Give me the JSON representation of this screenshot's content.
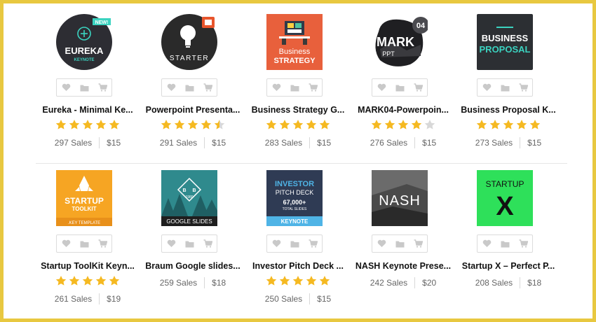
{
  "colors": {
    "star": "#f5b921",
    "star_empty": "#d8d8d8",
    "accent_gray": "#c9c9c9"
  },
  "action_icons": [
    "heart-icon",
    "folder-icon",
    "cart-icon"
  ],
  "items": [
    {
      "title": "Eureka - Minimal Ke...",
      "rating": 5,
      "sales": "297 Sales",
      "price": "$15",
      "thumb": {
        "name": "EUREKA",
        "sub": "KEYNOTE",
        "badge": "NEW!"
      }
    },
    {
      "title": "Powerpoint Presenta...",
      "rating": 4.5,
      "sales": "291 Sales",
      "price": "$15",
      "thumb": {
        "name": "STARTER"
      }
    },
    {
      "title": "Business Strategy G...",
      "rating": 5,
      "sales": "283 Sales",
      "price": "$15",
      "thumb": {
        "line1": "Business",
        "line2": "STRATEGY"
      }
    },
    {
      "title": "MARK04-Powerpoin...",
      "rating": 4,
      "sales": "276 Sales",
      "price": "$15",
      "thumb": {
        "name": "MARK",
        "sub": "PPT",
        "badge": "04"
      }
    },
    {
      "title": "Business Proposal K...",
      "rating": 5,
      "sales": "273 Sales",
      "price": "$15",
      "thumb": {
        "line1": "BUSINESS",
        "line2": "PROPOSAL"
      }
    },
    {
      "title": "Startup ToolKit Keyn...",
      "rating": 5,
      "sales": "261 Sales",
      "price": "$19",
      "thumb": {
        "line1": "STARTUP",
        "line2": "TOOLKIT",
        "sub": ".KEY TEMPLATE"
      }
    },
    {
      "title": "Braum Google slides...",
      "rating": 0,
      "sales": "259 Sales",
      "price": "$18",
      "thumb": {
        "letters": [
          "B",
          "B"
        ],
        "year": "1980",
        "caption": "GOOGLE SLIDES"
      }
    },
    {
      "title": "Investor Pitch Deck ...",
      "rating": 5,
      "sales": "250 Sales",
      "price": "$15",
      "thumb": {
        "line1": "INVESTOR",
        "line2": "PITCH DECK",
        "count": "67,000+",
        "count_sub": "TOTAL SLIDES",
        "caption": "KEYNOTE"
      }
    },
    {
      "title": "NASH Keynote Prese...",
      "rating": 0,
      "sales": "242 Sales",
      "price": "$20",
      "thumb": {
        "name": "NASH"
      }
    },
    {
      "title": "Startup X – Perfect P...",
      "rating": 0,
      "sales": "208 Sales",
      "price": "$18",
      "thumb": {
        "line1": "STARTUP",
        "line2": "X"
      }
    }
  ]
}
